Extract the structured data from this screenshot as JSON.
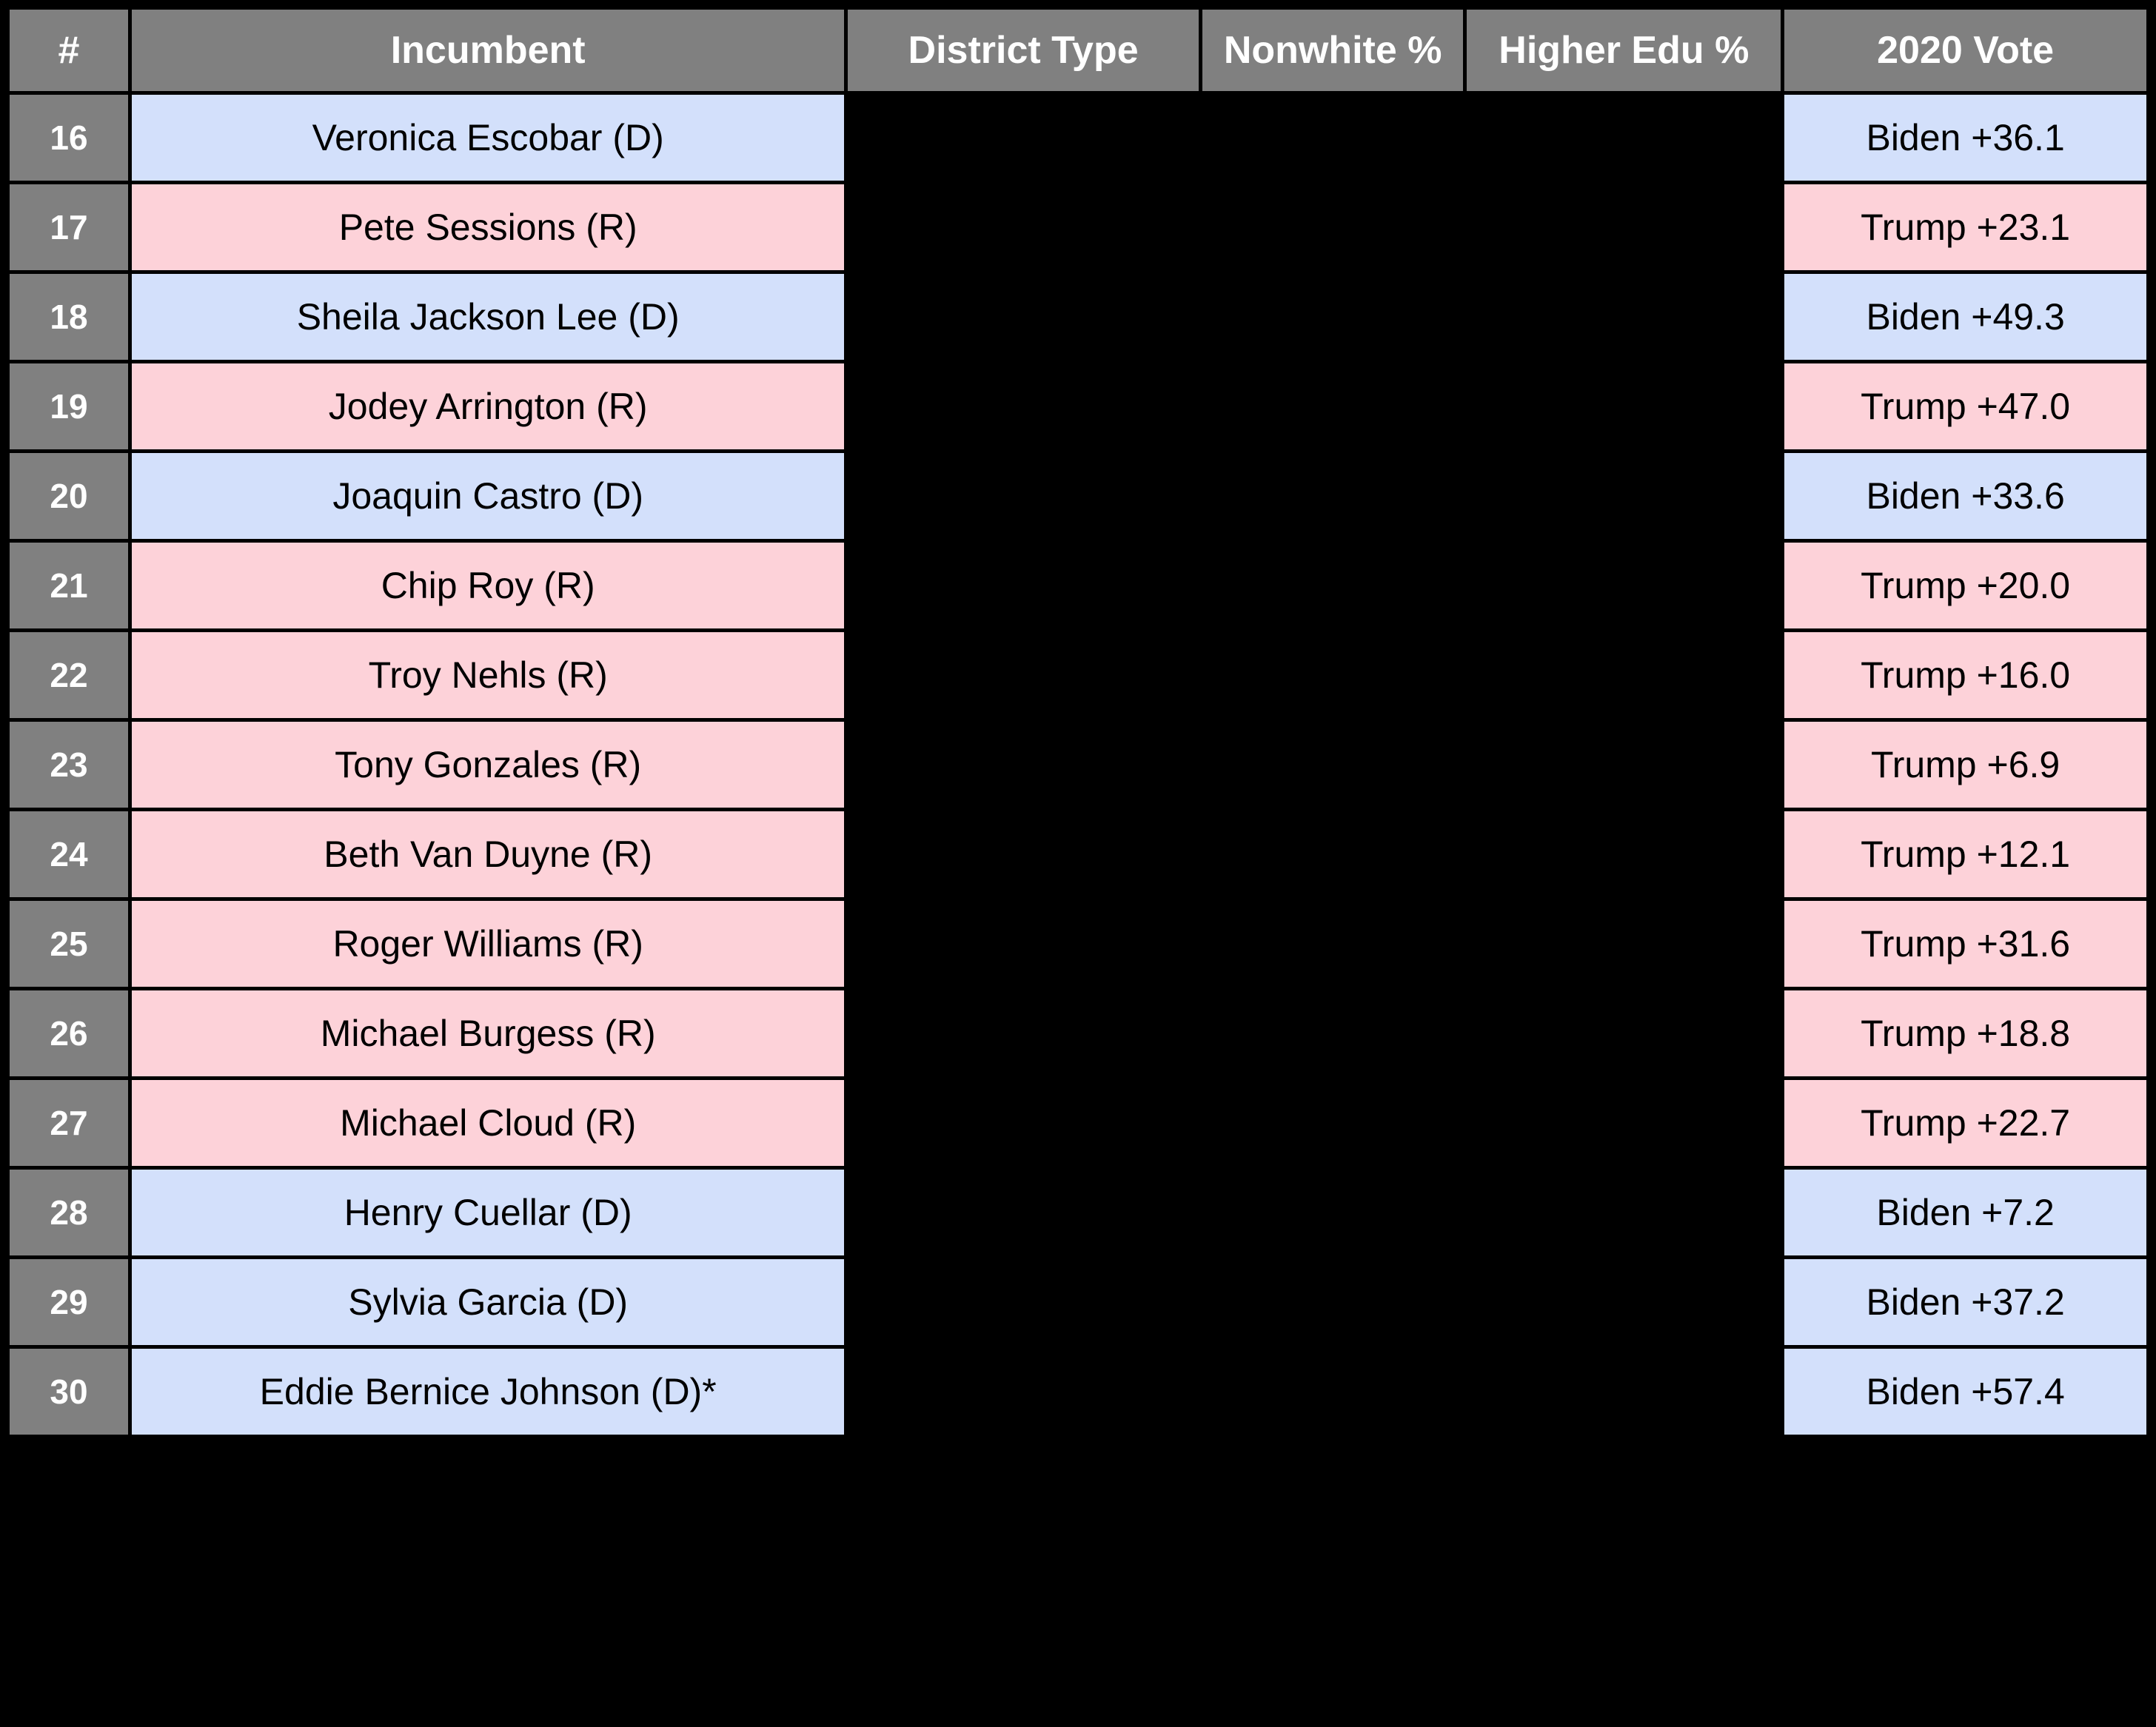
{
  "table": {
    "columns": [
      {
        "key": "num",
        "label": "#"
      },
      {
        "key": "incumbent",
        "label": "Incumbent"
      },
      {
        "key": "dtype",
        "label": "District Type"
      },
      {
        "key": "nonwhite",
        "label": "Nonwhite %"
      },
      {
        "key": "higher",
        "label": "Higher Edu %"
      },
      {
        "key": "vote",
        "label": "2020 Vote"
      }
    ],
    "colors": {
      "header_bg": "#808080",
      "header_text": "#ffffff",
      "num_bg": "#808080",
      "democrat_bg": "#d3e0fb",
      "republican_bg": "#fdd2d9",
      "page_bg": "#000000",
      "cell_text": "#000000"
    },
    "rows": [
      {
        "num": "16",
        "incumbent": "Veronica Escobar (D)",
        "party": "dem",
        "dtype": "",
        "nonwhite": "",
        "higher": "",
        "vote": "Biden +36.1"
      },
      {
        "num": "17",
        "incumbent": "Pete Sessions (R)",
        "party": "rep",
        "dtype": "",
        "nonwhite": "",
        "higher": "",
        "vote": "Trump +23.1"
      },
      {
        "num": "18",
        "incumbent": "Sheila Jackson Lee (D)",
        "party": "dem",
        "dtype": "",
        "nonwhite": "",
        "higher": "",
        "vote": "Biden +49.3"
      },
      {
        "num": "19",
        "incumbent": "Jodey Arrington (R)",
        "party": "rep",
        "dtype": "",
        "nonwhite": "",
        "higher": "",
        "vote": "Trump +47.0"
      },
      {
        "num": "20",
        "incumbent": "Joaquin Castro (D)",
        "party": "dem",
        "dtype": "",
        "nonwhite": "",
        "higher": "",
        "vote": "Biden +33.6"
      },
      {
        "num": "21",
        "incumbent": "Chip Roy (R)",
        "party": "rep",
        "dtype": "",
        "nonwhite": "",
        "higher": "",
        "vote": "Trump +20.0"
      },
      {
        "num": "22",
        "incumbent": "Troy Nehls (R)",
        "party": "rep",
        "dtype": "",
        "nonwhite": "",
        "higher": "",
        "vote": "Trump +16.0"
      },
      {
        "num": "23",
        "incumbent": "Tony Gonzales (R)",
        "party": "rep",
        "dtype": "",
        "nonwhite": "",
        "higher": "",
        "vote": "Trump +6.9"
      },
      {
        "num": "24",
        "incumbent": "Beth Van Duyne (R)",
        "party": "rep",
        "dtype": "",
        "nonwhite": "",
        "higher": "",
        "vote": "Trump +12.1"
      },
      {
        "num": "25",
        "incumbent": "Roger Williams (R)",
        "party": "rep",
        "dtype": "",
        "nonwhite": "",
        "higher": "",
        "vote": "Trump +31.6"
      },
      {
        "num": "26",
        "incumbent": "Michael Burgess (R)",
        "party": "rep",
        "dtype": "",
        "nonwhite": "",
        "higher": "",
        "vote": "Trump +18.8"
      },
      {
        "num": "27",
        "incumbent": "Michael Cloud (R)",
        "party": "rep",
        "dtype": "",
        "nonwhite": "",
        "higher": "",
        "vote": "Trump +22.7"
      },
      {
        "num": "28",
        "incumbent": "Henry Cuellar (D)",
        "party": "dem",
        "dtype": "",
        "nonwhite": "",
        "higher": "",
        "vote": "Biden +7.2"
      },
      {
        "num": "29",
        "incumbent": "Sylvia Garcia (D)",
        "party": "dem",
        "dtype": "",
        "nonwhite": "",
        "higher": "",
        "vote": "Biden +37.2"
      },
      {
        "num": "30",
        "incumbent": "Eddie Bernice Johnson (D)*",
        "party": "dem",
        "dtype": "",
        "nonwhite": "",
        "higher": "",
        "vote": "Biden +57.4"
      }
    ]
  }
}
